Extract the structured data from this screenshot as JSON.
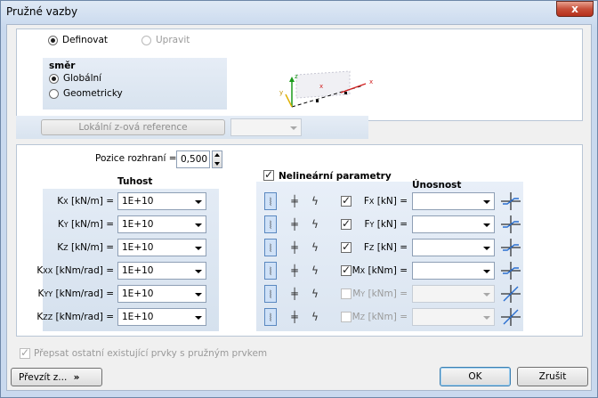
{
  "window": {
    "title": "Pružné vazby",
    "close_glyph": "x"
  },
  "mode": {
    "define_label": "Definovat",
    "edit_label": "Upravit"
  },
  "direction": {
    "group_label": "směr",
    "global_label": "Globální",
    "geometric_label": "Geometricky"
  },
  "axes_preview": {
    "z": "z",
    "y": "y",
    "x": "x"
  },
  "local_ref": {
    "button_label": "Lokální z-ová reference",
    "combo_value": ""
  },
  "interface": {
    "label": "Pozice rozhraní =",
    "value": "0,500"
  },
  "stiffness": {
    "heading": "Tuhost",
    "rows": [
      {
        "sym": "K",
        "sub": "X",
        "unit": "[kN/m] =",
        "value": "1E+10"
      },
      {
        "sym": "K",
        "sub": "Y",
        "unit": "[kN/m] =",
        "value": "1E+10"
      },
      {
        "sym": "K",
        "sub": "Z",
        "unit": "[kN/m] =",
        "value": "1E+10"
      },
      {
        "sym": "K",
        "sub": "XX",
        "unit": "[kNm/rad] =",
        "value": "1E+10"
      },
      {
        "sym": "K",
        "sub": "YY",
        "unit": "[kNm/rad] =",
        "value": "1E+10"
      },
      {
        "sym": "K",
        "sub": "ZZ",
        "unit": "[kNm/rad] =",
        "value": "1E+10"
      }
    ]
  },
  "nonlinear": {
    "label": "Nelineární parametry",
    "checked": true
  },
  "capacity": {
    "heading": "Únosnost",
    "rows": [
      {
        "sym": "F",
        "sub": "X",
        "unit": "[kN] =",
        "checked": true,
        "enabled": true
      },
      {
        "sym": "F",
        "sub": "Y",
        "unit": "[kN] =",
        "checked": true,
        "enabled": true
      },
      {
        "sym": "F",
        "sub": "Z",
        "unit": "[kN] =",
        "checked": true,
        "enabled": true
      },
      {
        "sym": "M",
        "sub": "X",
        "unit": "[kNm] =",
        "checked": true,
        "enabled": true
      },
      {
        "sym": "M",
        "sub": "Y",
        "unit": "[kNm] =",
        "checked": false,
        "enabled": false
      },
      {
        "sym": "M",
        "sub": "Z",
        "unit": "[kNm] =",
        "checked": false,
        "enabled": false
      }
    ]
  },
  "overwrite": {
    "label": "Přepsat ostatní existující prvky s pružným prvkem",
    "checked": true
  },
  "footer": {
    "take_label": "Převzít z...",
    "take_glyph": "»",
    "ok_label": "OK",
    "cancel_label": "Zrušit"
  },
  "colors": {
    "accent": "#3b79c9",
    "axis_x": "#d22020",
    "axis_z": "#1a9a1a",
    "axis_y": "#e0b000"
  }
}
